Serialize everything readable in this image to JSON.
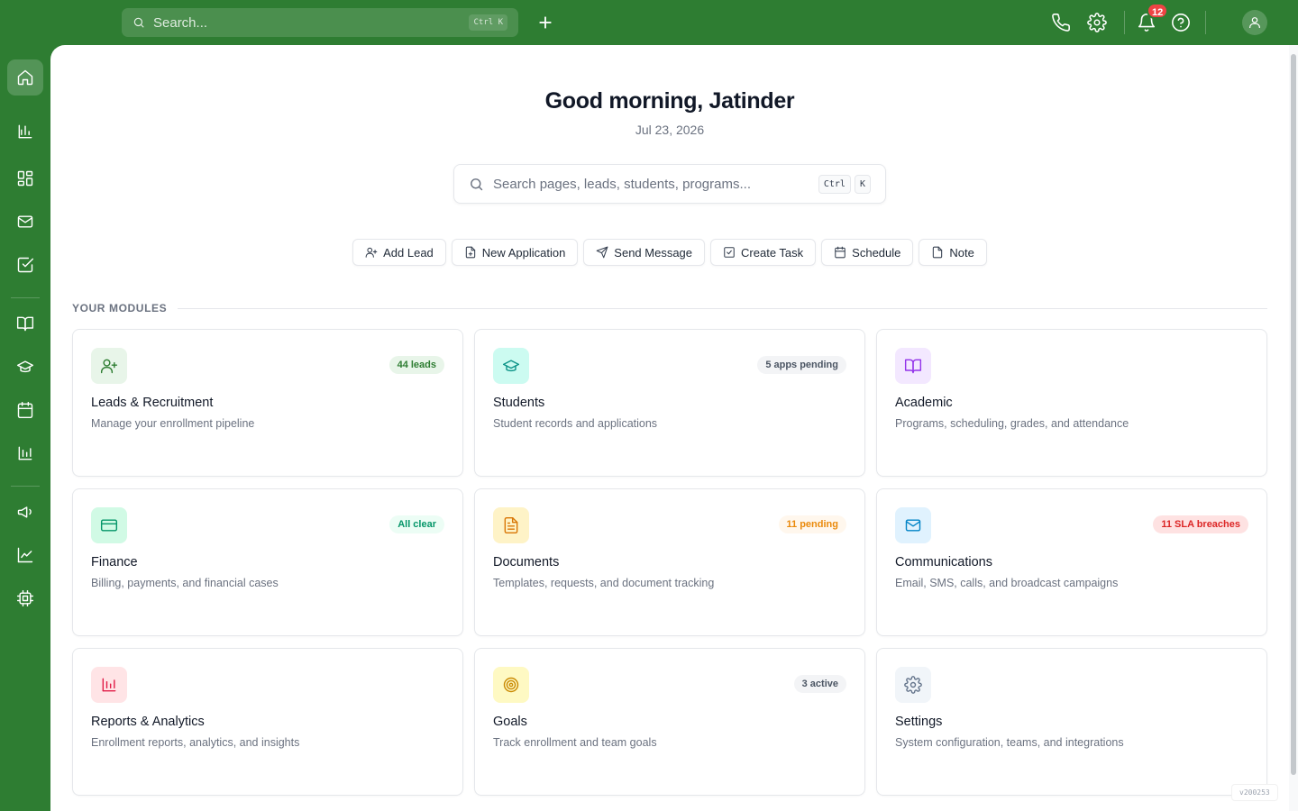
{
  "topbar": {
    "search_placeholder": "Search...",
    "search_shortcut": "Ctrl K",
    "notifications_count": "12"
  },
  "sidebar": {
    "items": [
      {
        "name": "home-icon",
        "active": true
      },
      {
        "name": "bar-chart-icon"
      },
      {
        "name": "dashboard-grid-icon"
      },
      {
        "name": "mail-icon"
      },
      {
        "name": "checkbox-icon"
      },
      {
        "name": "book-icon"
      },
      {
        "name": "graduation-cap-icon"
      },
      {
        "name": "calendar-icon"
      },
      {
        "name": "reports-icon"
      },
      {
        "name": "megaphone-icon"
      },
      {
        "name": "trending-icon"
      },
      {
        "name": "cpu-icon"
      }
    ]
  },
  "main": {
    "greeting": "Good morning, Jatinder",
    "date": "Jul 23, 2026",
    "search_placeholder": "Search pages, leads, students, programs...",
    "search_key1": "Ctrl",
    "search_key2": "K",
    "actions": [
      "Add Lead",
      "New Application",
      "Send Message",
      "Create Task",
      "Schedule",
      "Note"
    ],
    "section_title": "YOUR MODULES",
    "modules": [
      {
        "title": "Leads & Recruitment",
        "desc": "Manage your enrollment pipeline",
        "badge": "44 leads",
        "icon": "user-plus-icon",
        "icon_bg": "#e8f5e9",
        "icon_color": "#2e7d32",
        "badge_bg": "#e8f5e9",
        "badge_color": "#2e7d32"
      },
      {
        "title": "Students",
        "desc": "Student records and applications",
        "badge": "5 apps pending",
        "icon": "graduation-cap-icon",
        "icon_bg": "#ccfbf1",
        "icon_color": "#0d9488",
        "badge_bg": "#f3f4f6",
        "badge_color": "#4b5563"
      },
      {
        "title": "Academic",
        "desc": "Programs, scheduling, grades, and attendance",
        "badge": "",
        "icon": "book-open-icon",
        "icon_bg": "#f3e8ff",
        "icon_color": "#9333ea",
        "badge_bg": "",
        "badge_color": ""
      },
      {
        "title": "Finance",
        "desc": "Billing, payments, and financial cases",
        "badge": "All clear",
        "icon": "credit-card-icon",
        "icon_bg": "#d1fae5",
        "icon_color": "#059669",
        "badge_bg": "#ecfdf5",
        "badge_color": "#059669"
      },
      {
        "title": "Documents",
        "desc": "Templates, requests, and document tracking",
        "badge": "11 pending",
        "icon": "file-text-icon",
        "icon_bg": "#fef3c7",
        "icon_color": "#d97706",
        "badge_bg": "#fff7ed",
        "badge_color": "#ea8a0c"
      },
      {
        "title": "Communications",
        "desc": "Email, SMS, calls, and broadcast campaigns",
        "badge": "11 SLA breaches",
        "icon": "mail-icon",
        "icon_bg": "#e0f2fe",
        "icon_color": "#0284c7",
        "badge_bg": "#fee2e2",
        "badge_color": "#dc2626"
      },
      {
        "title": "Reports & Analytics",
        "desc": "Enrollment reports, analytics, and insights",
        "badge": "",
        "icon": "bar-chart-icon",
        "icon_bg": "#ffe4e6",
        "icon_color": "#e11d48",
        "badge_bg": "",
        "badge_color": ""
      },
      {
        "title": "Goals",
        "desc": "Track enrollment and team goals",
        "badge": "3 active",
        "icon": "target-icon",
        "icon_bg": "#fef9c3",
        "icon_color": "#ca8a04",
        "badge_bg": "#f3f4f6",
        "badge_color": "#4b5563"
      },
      {
        "title": "Settings",
        "desc": "System configuration, teams, and integrations",
        "badge": "",
        "icon": "gear-icon",
        "icon_bg": "#f1f5f9",
        "icon_color": "#64748b",
        "badge_bg": "",
        "badge_color": ""
      }
    ],
    "version": "v200253"
  }
}
